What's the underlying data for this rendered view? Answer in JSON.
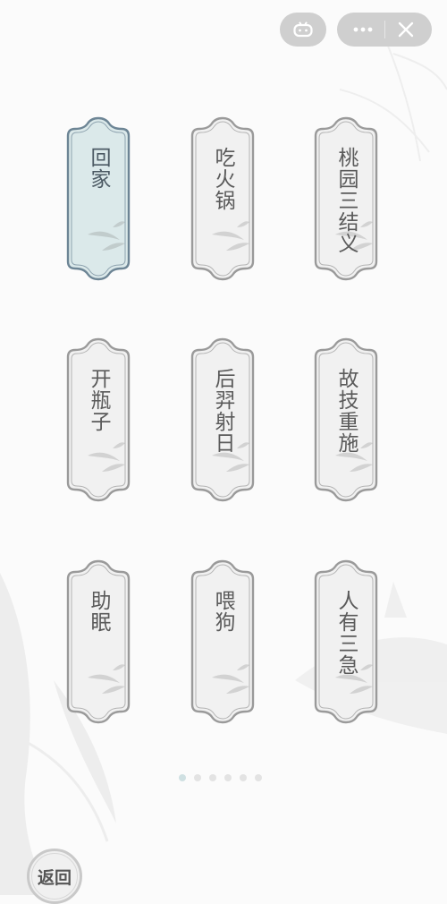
{
  "header": {
    "game_icon": "gamepad-icon",
    "more_icon": "more-dots-icon",
    "close_icon": "close-icon"
  },
  "levels": [
    {
      "label": "回家",
      "active": true
    },
    {
      "label": "吃火锅",
      "active": false
    },
    {
      "label": "桃园三结义",
      "active": false
    },
    {
      "label": "开瓶子",
      "active": false
    },
    {
      "label": "后羿射日",
      "active": false
    },
    {
      "label": "故技重施",
      "active": false
    },
    {
      "label": "助眠",
      "active": false
    },
    {
      "label": "喂狗",
      "active": false
    },
    {
      "label": "人有三急",
      "active": false
    }
  ],
  "pagination": {
    "total": 6,
    "current": 1
  },
  "back_button": {
    "label": "返回"
  },
  "colors": {
    "active_fill": "#dbe9ea",
    "active_border": "#6d8595",
    "card_fill": "#f1f1f1",
    "card_border": "#9a9a9a",
    "capsule": "#cfcfcf"
  }
}
